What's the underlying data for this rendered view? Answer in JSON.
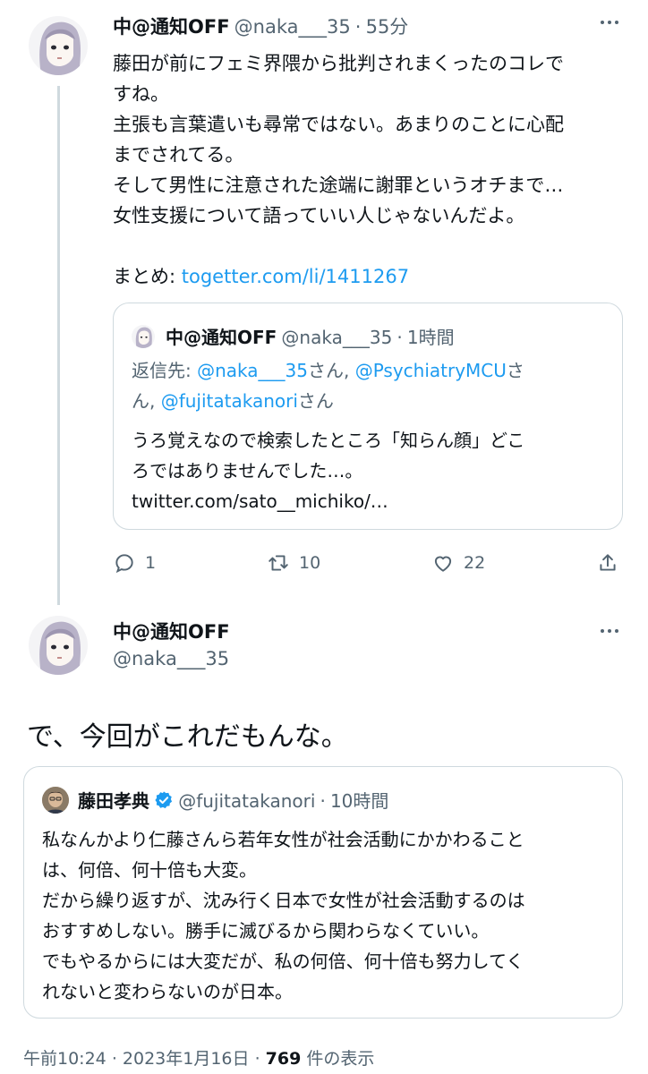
{
  "colors": {
    "accent": "#1d9bf0",
    "secondary_text": "#536471",
    "border": "#cfd9de"
  },
  "tweet1": {
    "name": "中@通知OFF",
    "handle": "@naka___35",
    "time": "55分",
    "lines": [
      "藤田が前にフェミ界隈から批判されまくったのコレで",
      "すね。",
      "主張も言葉遣いも尋常ではない。あまりのことに心配",
      "までされてる。",
      "そして男性に注意された途端に謝罪というオチまで…",
      "女性支援について語っていい人じゃないんだよ。"
    ],
    "summary_label": "まとめ: ",
    "summary_link": "togetter.com/li/1411267",
    "quote": {
      "name": "中@通知OFF",
      "handle": "@naka___35",
      "time": "1時間",
      "reply_prefix": "返信先: ",
      "reply_line1_mention1": "@naka___35",
      "reply_line1_sep": "さん, ",
      "reply_line1_mention2": "@PsychiatryMCU",
      "reply_line1_suffix": "さ",
      "reply_line2_start": "ん, ",
      "reply_line2_mention": "@fujitatakanori",
      "reply_line2_suffix": "さん",
      "lines": [
        "うろ覚えなので検索したところ「知らん顔」どこ",
        "ろではありませんでした…。",
        "twitter.com/sato__michiko/…"
      ]
    },
    "actions": {
      "reply_count": "1",
      "retweet_count": "10",
      "like_count": "22"
    }
  },
  "tweet2": {
    "name": "中@通知OFF",
    "handle": "@naka___35",
    "text": "で、今回がこれだもんな。",
    "quote": {
      "name": "藤田孝典",
      "handle": "@fujitatakanori",
      "time": "10時間",
      "lines": [
        "私なんかより仁藤さんら若年女性が社会活動にかかわること",
        "は、何倍、何十倍も大変。",
        "だから繰り返すが、沈み行く日本で女性が社会活動するのは",
        "おすすめしない。勝手に滅びるから関わらなくていい。",
        "でもやるからには大変だが、私の何倍、何十倍も努力してく",
        "れないと変わらないのが日本。"
      ]
    },
    "footer": {
      "time": "午前10:24",
      "date": "2023年1月16日",
      "views": "769",
      "views_label": "件の表示"
    }
  }
}
